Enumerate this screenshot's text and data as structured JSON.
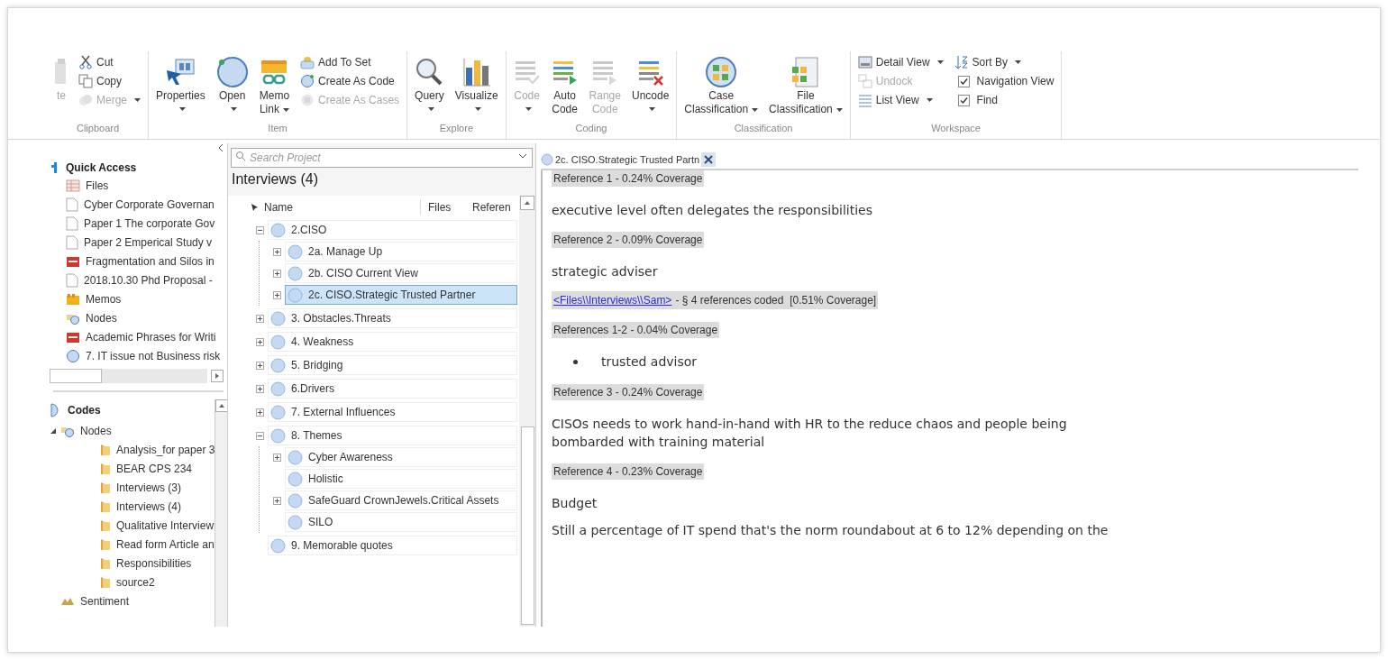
{
  "ribbon": {
    "groups": [
      {
        "label": "Clipboard",
        "items": [
          {
            "kind": "large",
            "lines": [
              "te"
            ],
            "dropdown": false,
            "disabled": true
          },
          {
            "kind": "column",
            "items": [
              {
                "kind": "small",
                "label": "Cut",
                "dropdown": false,
                "disabled": false
              },
              {
                "kind": "small",
                "label": "Copy",
                "dropdown": false,
                "disabled": false
              },
              {
                "kind": "small",
                "label": "Merge",
                "dropdown": true,
                "disabled": true
              }
            ]
          }
        ]
      },
      {
        "label": "Item",
        "items": [
          {
            "kind": "large",
            "lines": [
              "Properties"
            ],
            "dropdown": true,
            "disabled": false
          },
          {
            "kind": "large",
            "lines": [
              "Open"
            ],
            "dropdown": true,
            "disabled": false
          },
          {
            "kind": "large",
            "lines": [
              "Memo",
              "Link"
            ],
            "dropdown": true,
            "disabled": false
          },
          {
            "kind": "column",
            "items": [
              {
                "kind": "small",
                "label": "Add To Set",
                "dropdown": false,
                "disabled": false
              },
              {
                "kind": "small",
                "label": "Create As Code",
                "dropdown": false,
                "disabled": false
              },
              {
                "kind": "small",
                "label": "Create As Cases",
                "dropdown": false,
                "disabled": true
              }
            ]
          }
        ]
      },
      {
        "label": "Explore",
        "items": [
          {
            "kind": "large",
            "lines": [
              "Query"
            ],
            "dropdown": true,
            "disabled": false
          },
          {
            "kind": "large",
            "lines": [
              "Visualize"
            ],
            "dropdown": true,
            "disabled": false
          }
        ]
      },
      {
        "label": "Coding",
        "items": [
          {
            "kind": "large",
            "lines": [
              "Code"
            ],
            "dropdown": true,
            "disabled": true
          },
          {
            "kind": "large",
            "lines": [
              "Auto",
              "Code"
            ],
            "dropdown": false,
            "disabled": false
          },
          {
            "kind": "large",
            "lines": [
              "Range",
              "Code"
            ],
            "dropdown": false,
            "disabled": true
          },
          {
            "kind": "large",
            "lines": [
              "Uncode"
            ],
            "dropdown": true,
            "disabled": false
          }
        ]
      },
      {
        "label": "Classification",
        "items": [
          {
            "kind": "large",
            "lines": [
              "Case",
              "Classification"
            ],
            "dropdown": true,
            "disabled": false
          },
          {
            "kind": "large",
            "lines": [
              "File",
              "Classification"
            ],
            "dropdown": true,
            "disabled": false
          }
        ]
      },
      {
        "label": "Workspace",
        "items": [
          {
            "kind": "column",
            "items": [
              {
                "kind": "small",
                "label": "Detail View",
                "dropdown": true,
                "disabled": false
              },
              {
                "kind": "small",
                "label": "Undock",
                "dropdown": false,
                "disabled": true
              },
              {
                "kind": "small",
                "label": "List View",
                "dropdown": true,
                "disabled": false
              }
            ]
          },
          {
            "kind": "column",
            "items": [
              {
                "kind": "small",
                "label": "Sort By",
                "dropdown": true,
                "disabled": false
              },
              {
                "kind": "check",
                "label": "Navigation View",
                "checked": true
              },
              {
                "kind": "check",
                "label": "Find",
                "checked": true
              }
            ]
          }
        ]
      }
    ]
  },
  "navigation": {
    "quick_access": {
      "title": "Quick Access",
      "items": [
        {
          "label": "Files",
          "kind": "files"
        },
        {
          "label": "Cyber Corporate Governan",
          "kind": "document"
        },
        {
          "label": "Paper 1 The corporate Gov",
          "kind": "document"
        },
        {
          "label": "Paper 2 Emperical Study v",
          "kind": "document"
        },
        {
          "label": "Fragmentation and Silos in",
          "kind": "pdf"
        },
        {
          "label": "2018.10.30 Phd Proposal -",
          "kind": "document"
        },
        {
          "label": "Memos",
          "kind": "memos"
        },
        {
          "label": "Nodes",
          "kind": "nodes"
        },
        {
          "label": "Academic Phrases for Writi",
          "kind": "pdf"
        },
        {
          "label": "7. IT issue not Business risk",
          "kind": "code"
        }
      ]
    },
    "codes": {
      "title": "Codes",
      "items": [
        {
          "label": "Nodes",
          "kind": "nodes",
          "expanded": true,
          "children": [
            {
              "label": "Analysis_for paper 3",
              "kind": "folder"
            },
            {
              "label": "BEAR CPS 234",
              "kind": "folder"
            },
            {
              "label": "Interviews (3)",
              "kind": "folder"
            },
            {
              "label": "Interviews (4)",
              "kind": "folder"
            },
            {
              "label": "Qualitative Interview",
              "kind": "folder"
            },
            {
              "label": "Read form Article an",
              "kind": "folder"
            },
            {
              "label": "Responsibilities",
              "kind": "folder"
            },
            {
              "label": "source2",
              "kind": "folder"
            }
          ]
        },
        {
          "label": "Sentiment",
          "kind": "sentiment"
        }
      ]
    }
  },
  "list": {
    "search": {
      "placeholder": "Search Project"
    },
    "title": "Interviews (4)",
    "columns": [
      "Name",
      "Files",
      "Referen"
    ],
    "nodes": [
      {
        "label": "2.CISO",
        "expanded": true,
        "selected": false,
        "children": [
          {
            "label": "2a. Manage Up",
            "expanded": false,
            "selected": false
          },
          {
            "label": "2b. CISO Current View",
            "expanded": false,
            "selected": false
          },
          {
            "label": "2c. CISO.Strategic Trusted Partner",
            "expanded": false,
            "selected": true
          }
        ]
      },
      {
        "label": "3. Obstacles.Threats",
        "expanded": false,
        "selected": false
      },
      {
        "label": "4. Weakness",
        "expanded": false,
        "selected": false
      },
      {
        "label": "5. Bridging",
        "expanded": false,
        "selected": false
      },
      {
        "label": "6.Drivers",
        "expanded": false,
        "selected": false
      },
      {
        "label": "7. External Influences",
        "expanded": false,
        "selected": false
      },
      {
        "label": "8. Themes",
        "expanded": true,
        "selected": false,
        "children": [
          {
            "label": "Cyber Awareness",
            "expanded": false,
            "selected": false
          },
          {
            "label": "Holistic",
            "selected": false
          },
          {
            "label": "SafeGuard CrownJewels.Critical Assets",
            "expanded": false,
            "selected": false
          },
          {
            "label": "SILO",
            "selected": false
          }
        ]
      },
      {
        "label": "9. Memorable quotes",
        "selected": false
      }
    ]
  },
  "detail": {
    "tab": {
      "label": "2c. CISO.Strategic Trusted Partn"
    },
    "blocks": [
      {
        "kind": "heading",
        "text": "Reference 1 - 0.24% Coverage"
      },
      {
        "kind": "text",
        "text": "executive level often delegates the responsibilities"
      },
      {
        "kind": "heading",
        "text": "Reference 2 - 0.09% Coverage"
      },
      {
        "kind": "text",
        "text": "strategic adviser"
      },
      {
        "kind": "source",
        "link": "<Files\\\\Interviews\\\\Sam>",
        "text": "- § 4 references coded  [0.51% Coverage]"
      },
      {
        "kind": "heading",
        "text": "References 1-2 - 0.04% Coverage"
      },
      {
        "kind": "bullet",
        "text": "trusted advisor"
      },
      {
        "kind": "heading",
        "text": "Reference 3 - 0.24% Coverage"
      },
      {
        "kind": "text",
        "text": "CISOs needs to work hand-in-hand with HR to the reduce chaos and people being bombarded with training material"
      },
      {
        "kind": "heading",
        "text": "Reference 4 - 0.23% Coverage"
      },
      {
        "kind": "text",
        "text": "Budget"
      },
      {
        "kind": "text",
        "text": "Still a percentage of IT spend that's the norm roundabout at 6 to 12% depending on the"
      }
    ]
  }
}
